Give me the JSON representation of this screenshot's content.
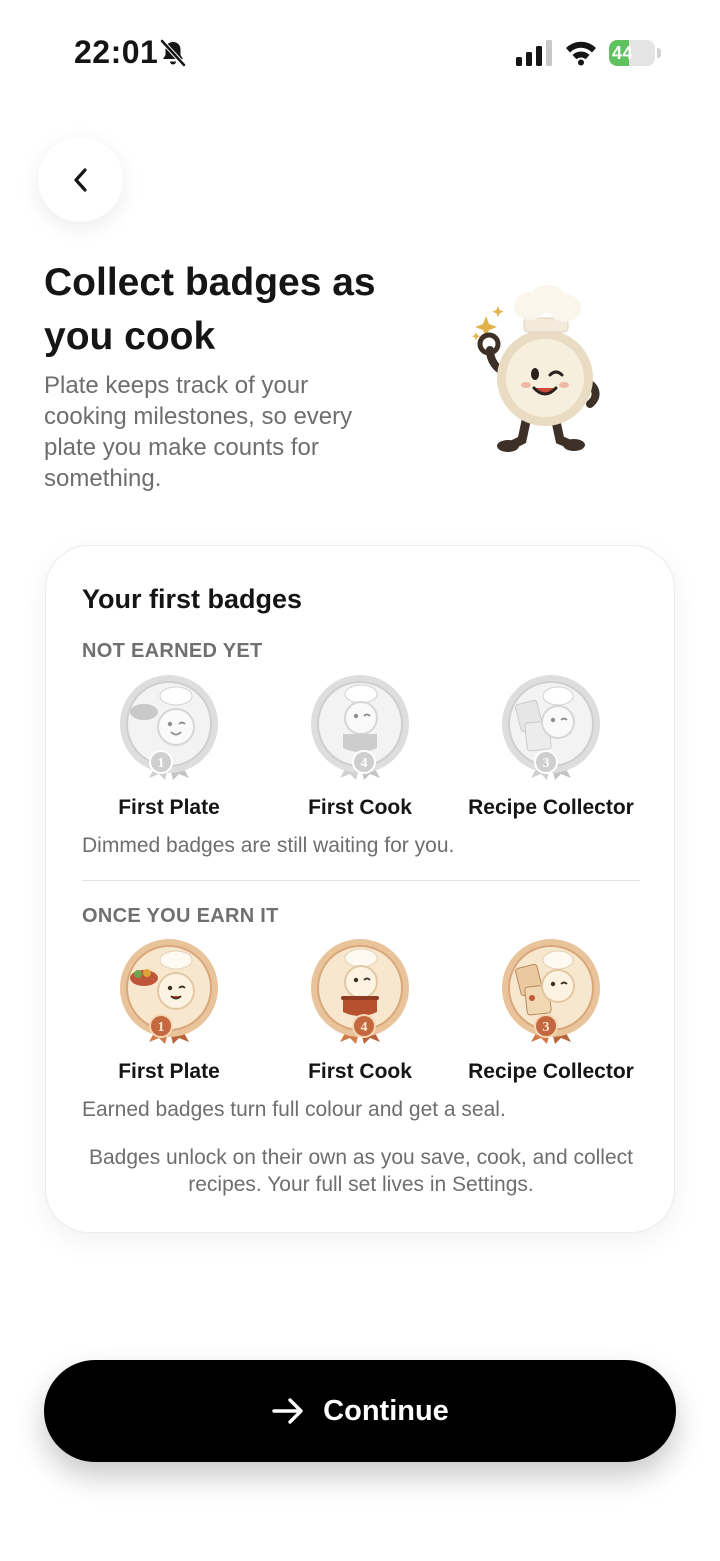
{
  "status_bar": {
    "time": "22:01",
    "battery_level": "44",
    "battery_fraction": 0.44,
    "icons": [
      "bell-off-icon",
      "cellular-signal-icon",
      "wifi-icon",
      "battery-charging-icon"
    ]
  },
  "nav": {
    "back_icon": "chevron-left-icon"
  },
  "header": {
    "title": "Collect badges as you cook",
    "subtitle": "Plate keeps track of your cooking milestones, so every plate you make counts for something.",
    "mascot": "chef-plate-mascot-winking"
  },
  "card": {
    "title": "Your first badges",
    "locked_section": {
      "label": "NOT EARNED YET",
      "note": "Dimmed badges are still waiting for you.",
      "badges": [
        {
          "name": "First Plate",
          "number": "1",
          "icon": "plate-badge-icon"
        },
        {
          "name": "First Cook",
          "number": "4",
          "icon": "cooking-pot-badge-icon"
        },
        {
          "name": "Recipe Collector",
          "number": "3",
          "icon": "recipe-cards-badge-icon"
        }
      ]
    },
    "earned_section": {
      "label": "ONCE YOU EARN IT",
      "note": "Earned badges turn full colour and get a seal.",
      "badges": [
        {
          "name": "First Plate",
          "number": "1",
          "icon": "plate-badge-icon"
        },
        {
          "name": "First Cook",
          "number": "4",
          "icon": "cooking-pot-badge-icon"
        },
        {
          "name": "Recipe Collector",
          "number": "3",
          "icon": "recipe-cards-badge-icon"
        }
      ]
    },
    "footnote": "Badges unlock on their own as you save, cook, and collect recipes. Your full set lives in Settings."
  },
  "continue_button": {
    "label": "Continue",
    "icon": "arrow-right-icon"
  },
  "colors": {
    "primary": "#000000",
    "text": "#151515",
    "muted_text": "#6e6e6e",
    "battery_green": "#5fc25f",
    "badge_gold": "#d9a77a",
    "badge_locked": "#dcdcdc"
  }
}
